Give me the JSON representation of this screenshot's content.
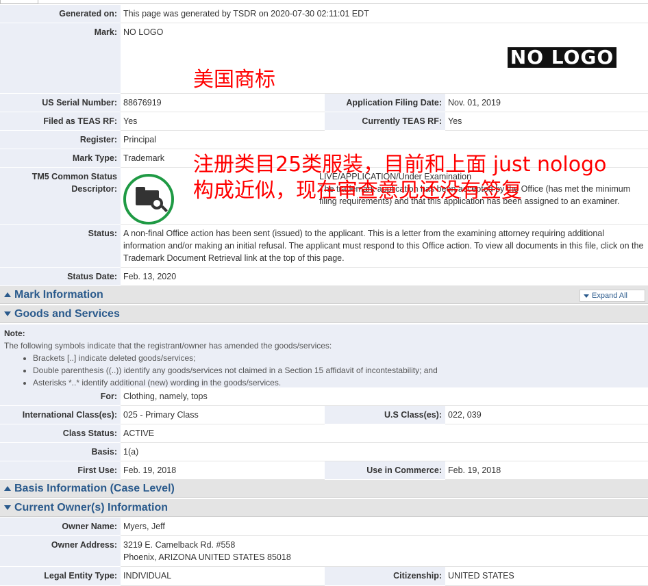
{
  "generated": {
    "label": "Generated on:",
    "value": "This page was generated by TSDR on 2020-07-30 02:11:01 EDT"
  },
  "mark": {
    "label": "Mark:",
    "value": "NO LOGO",
    "logo_text": "NO LOGO"
  },
  "annotation1": "美国商标",
  "annotation2_line1": "注册类目25类服装，目前和上面 just nologo",
  "annotation2_line2": "构成近似，现在审查意见还没有签复",
  "serial": {
    "label": "US Serial Number:",
    "value": "88676919"
  },
  "filing_date": {
    "label": "Application Filing Date:",
    "value": "Nov. 01, 2019"
  },
  "teas_rf": {
    "label": "Filed as TEAS RF:",
    "value": "Yes"
  },
  "current_teas_rf": {
    "label": "Currently TEAS RF:",
    "value": "Yes"
  },
  "register": {
    "label": "Register:",
    "value": "Principal"
  },
  "mark_type": {
    "label": "Mark Type:",
    "value": "Trademark"
  },
  "tm5": {
    "label": "TM5 Common Status Descriptor:",
    "line1": "LIVE/APPLICATION/Under Examination",
    "line2": "The trademark application has been accepted by the Office (has met the minimum filing requirements) and that this application has been assigned to an examiner."
  },
  "status": {
    "label": "Status:",
    "value": "A non-final Office action has been sent (issued) to the applicant. This is a letter from the examining attorney requiring additional information and/or making an initial refusal. The applicant must respond to this Office action. To view all documents in this file, click on the Trademark Document Retrieval link at the top of this page."
  },
  "status_date": {
    "label": "Status Date:",
    "value": "Feb. 13, 2020"
  },
  "sections": {
    "mark_info": "Mark Information",
    "goods_services": "Goods and Services",
    "basis_info": "Basis Information (Case Level)",
    "owner_info": "Current Owner(s) Information",
    "expand_all": "Expand All"
  },
  "note": {
    "title": "Note:",
    "intro": "The following symbols indicate that the registrant/owner has amended the goods/services:",
    "items": [
      "Brackets [..] indicate deleted goods/services;",
      "Double parenthesis ((..)) identify any goods/services not claimed in a Section 15 affidavit of incontestability; and",
      "Asterisks *..* identify additional (new) wording in the goods/services."
    ]
  },
  "for": {
    "label": "For:",
    "value": "Clothing, namely, tops"
  },
  "intl_class": {
    "label": "International Class(es):",
    "value": "025 - Primary Class"
  },
  "us_class": {
    "label": "U.S Class(es):",
    "value": "022, 039"
  },
  "class_status": {
    "label": "Class Status:",
    "value": "ACTIVE"
  },
  "basis": {
    "label": "Basis:",
    "value": "1(a)"
  },
  "first_use": {
    "label": "First Use:",
    "value": "Feb. 19, 2018"
  },
  "use_commerce": {
    "label": "Use in Commerce:",
    "value": "Feb. 19, 2018"
  },
  "owner_name": {
    "label": "Owner Name:",
    "value": "Myers, Jeff"
  },
  "owner_address": {
    "label": "Owner Address:",
    "line1": "3219 E. Camelback Rd. #558",
    "line2": "Phoenix, ARIZONA UNITED STATES 85018"
  },
  "legal_entity": {
    "label": "Legal Entity Type:",
    "value": "INDIVIDUAL"
  },
  "citizenship": {
    "label": "Citizenship:",
    "value": "UNITED STATES"
  }
}
